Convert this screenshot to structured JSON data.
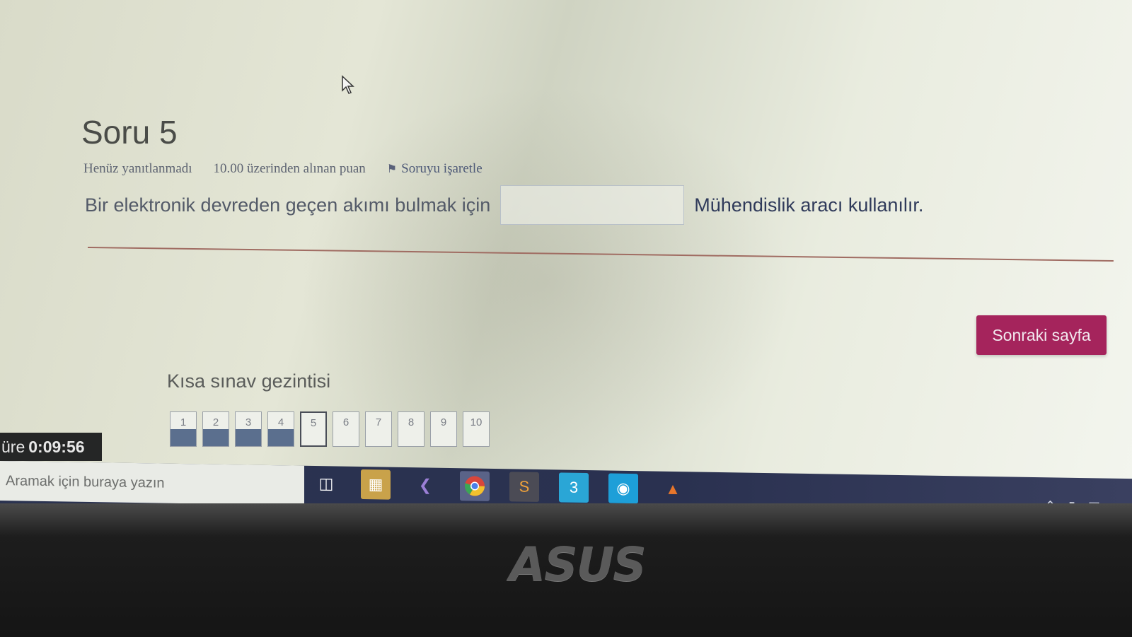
{
  "question": {
    "title": "Soru 5",
    "status": "Henüz yanıtlanmadı",
    "score": "10.00 üzerinden alınan puan",
    "flag_label": "Soruyu işaretle",
    "text_before": "Bir elektronik devreden geçen akımı bulmak için",
    "answer_value": "",
    "text_after": "Mühendislik aracı kullanılır."
  },
  "next_button": "Sonraki sayfa",
  "quiz_nav": {
    "title": "Kısa sınav gezintisi",
    "items": [
      {
        "label": "1",
        "state": "answered"
      },
      {
        "label": "2",
        "state": "answered"
      },
      {
        "label": "3",
        "state": "answered"
      },
      {
        "label": "4",
        "state": "answered"
      },
      {
        "label": "5",
        "state": "current"
      },
      {
        "label": "6",
        "state": "empty"
      },
      {
        "label": "7",
        "state": "empty"
      },
      {
        "label": "8",
        "state": "empty"
      },
      {
        "label": "9",
        "state": "empty"
      },
      {
        "label": "10",
        "state": "empty"
      }
    ]
  },
  "timer": {
    "prefix": "üre",
    "value": "0:09:56"
  },
  "taskbar": {
    "search_placeholder": "Aramak için buraya yazın",
    "icons": [
      "task-view-icon",
      "database-tool-icon",
      "visual-studio-icon",
      "chrome-icon",
      "sublime-text-icon",
      "app-3-icon",
      "camera-app-icon",
      "matlab-icon"
    ]
  },
  "bezel": {
    "brand": "ASUS"
  },
  "colors": {
    "next_button": "#a5245c",
    "answered_box": "#5b6f8e",
    "taskbar": "#2b3350"
  }
}
